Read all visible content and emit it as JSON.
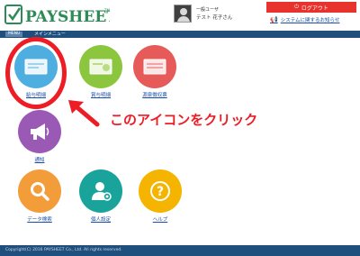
{
  "header": {
    "logo": {
      "text": "PAYSHEET",
      "tm": "TM"
    },
    "user": {
      "role": "一般ユーザ",
      "name": "テスト 花子さん"
    },
    "logout_label": "ログアウト",
    "notice_label": "システムに関するお知らせ"
  },
  "nav": {
    "tag": "MENU",
    "title": "メインメニュー"
  },
  "menu": {
    "items": [
      {
        "label": "給与明細",
        "icon": "payslip-icon",
        "color": "#4eaee0"
      },
      {
        "label": "賞与明細",
        "icon": "bonus-icon",
        "color": "#8cc63f"
      },
      {
        "label": "源泉徴収票",
        "icon": "withholding-slip-icon",
        "color": "#e65a5a"
      },
      {
        "label": "通知",
        "icon": "megaphone-icon",
        "color": "#9b59b6"
      },
      {
        "label": "データ検索",
        "icon": "search-icon",
        "color": "#f39c3a"
      },
      {
        "label": "個人設定",
        "icon": "user-settings-icon",
        "color": "#1aa39b"
      },
      {
        "label": "ヘルプ",
        "icon": "help-icon",
        "color": "#f4b400"
      }
    ]
  },
  "annotation": {
    "callout": "このアイコンをクリック",
    "color": "#ee1c25"
  },
  "footer": {
    "copyright": "Copyright(C) 2016 PAYSHEET Co., Ltd. All rights reserved."
  }
}
